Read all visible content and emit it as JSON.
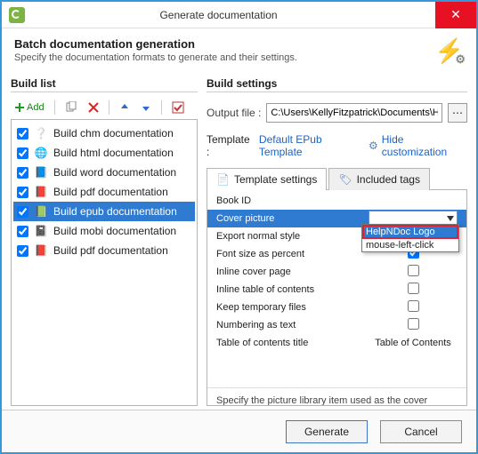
{
  "window": {
    "title": "Generate documentation"
  },
  "header": {
    "title": "Batch documentation generation",
    "subtitle": "Specify the documentation formats to generate and their settings."
  },
  "buildlist": {
    "title": "Build list",
    "add_label": "Add",
    "items": [
      {
        "label": "Build chm documentation",
        "checked": true,
        "selected": false,
        "icon": "chm"
      },
      {
        "label": "Build html documentation",
        "checked": true,
        "selected": false,
        "icon": "html"
      },
      {
        "label": "Build word documentation",
        "checked": true,
        "selected": false,
        "icon": "word"
      },
      {
        "label": "Build pdf documentation",
        "checked": true,
        "selected": false,
        "icon": "pdf"
      },
      {
        "label": "Build epub documentation",
        "checked": true,
        "selected": true,
        "icon": "epub"
      },
      {
        "label": "Build mobi documentation",
        "checked": true,
        "selected": false,
        "icon": "mobi"
      },
      {
        "label": "Build pdf documentation",
        "checked": true,
        "selected": false,
        "icon": "pdf"
      }
    ]
  },
  "settings": {
    "title": "Build settings",
    "output_label": "Output file :",
    "output_value": "C:\\Users\\KellyFitzpatrick\\Documents\\HelpNDoc",
    "template_label": "Template :",
    "template_value": "Default EPub Template",
    "hide_label": "Hide customization",
    "tabs": {
      "template": "Template settings",
      "included": "Included tags"
    },
    "props": [
      {
        "label": "Book ID",
        "type": "text",
        "value": ""
      },
      {
        "label": "Cover picture",
        "type": "combo",
        "value": "",
        "selected": true
      },
      {
        "label": "Export normal style",
        "type": "check",
        "value": false
      },
      {
        "label": "Font size as percent",
        "type": "check",
        "value": true
      },
      {
        "label": "Inline cover page",
        "type": "check",
        "value": false
      },
      {
        "label": "Inline table of contents",
        "type": "check",
        "value": false
      },
      {
        "label": "Keep temporary files",
        "type": "check",
        "value": false
      },
      {
        "label": "Numbering as text",
        "type": "check",
        "value": false
      },
      {
        "label": "Table of contents title",
        "type": "text",
        "value": "Table of Contents"
      }
    ],
    "dropdown": [
      "HelpNDoc Logo",
      "mouse-left-click"
    ],
    "hint": "Specify the picture library item used as the cover picture for the book. Recommended formats are JPEG or PNG and size ..."
  },
  "footer": {
    "generate": "Generate",
    "cancel": "Cancel"
  }
}
